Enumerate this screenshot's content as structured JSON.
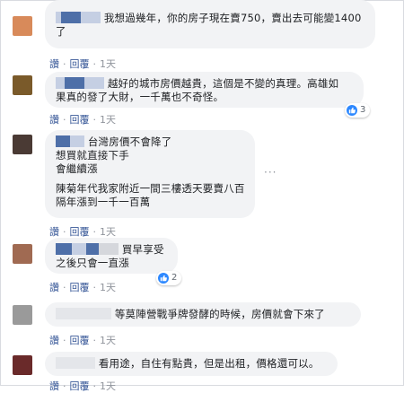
{
  "comments": [
    {
      "avatar_color": "#d88a5a",
      "lines": [
        "我想過幾年，你的房子現在賣750，賣出去可能變1400",
        "了"
      ],
      "actions": {
        "like": "讚",
        "reply": "回覆",
        "time": "1天"
      }
    },
    {
      "avatar_color": "#7a5a2a",
      "lines": [
        "越好的城市房價越貴，這個是不變的真理。高雄如",
        "果真的發了大財，一千萬也不奇怪。"
      ],
      "actions": {
        "like": "讚",
        "reply": "回覆",
        "time": "1天"
      },
      "reaction_count": "3"
    },
    {
      "avatar_color": "#4a3a34",
      "lines": [
        "台灣房價不會降了",
        "想買就直接下手",
        "會繼續漲",
        "",
        "陳菊年代我家附近一間三樓透天要賣八百",
        "隔年漲到一千一百萬"
      ],
      "actions": {
        "like": "讚",
        "reply": "回覆",
        "time": "1天"
      }
    },
    {
      "avatar_color": "#a06a52",
      "lines": [
        "買早享受",
        "之後只會一直漲"
      ],
      "actions": {
        "like": "讚",
        "reply": "回覆",
        "time": "1天"
      },
      "reaction_count": "2"
    },
    {
      "avatar_color": "#9a9a9a",
      "lines": [
        "等莫陣營戰爭牌發酵的時候，房價就會下來了"
      ],
      "actions": {
        "like": "讚",
        "reply": "回覆",
        "time": "1天"
      }
    },
    {
      "avatar_color": "#6a2a2a",
      "lines": [
        "看用途，自住有點貴，但是出租，價格還可以。"
      ],
      "actions": {
        "like": "讚",
        "reply": "回覆",
        "time": "1天"
      }
    }
  ],
  "more_dots": "···",
  "colors": {
    "link": "#385898",
    "bubble": "#f2f3f5",
    "like_blue": "#2d88ff"
  }
}
